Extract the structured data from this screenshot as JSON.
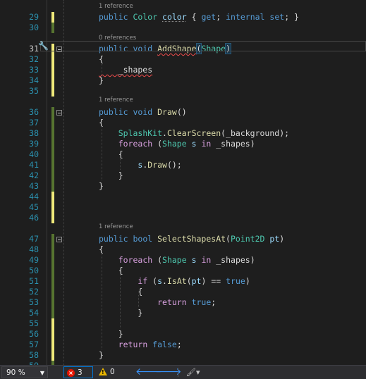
{
  "editor": {
    "lines": [
      {
        "n": "29",
        "lens": "1 reference",
        "tokens": [
          [
            "kw",
            "public "
          ],
          [
            "ty",
            "Color"
          ],
          [
            "pl",
            " "
          ],
          [
            "pm",
            "color"
          ],
          [
            "pl",
            " { "
          ],
          [
            "kw",
            "get"
          ],
          [
            "pl",
            "; "
          ],
          [
            "kw",
            "internal"
          ],
          [
            "pl",
            " "
          ],
          [
            "kw",
            "set"
          ],
          [
            "pl",
            "; }"
          ]
        ]
      },
      {
        "n": "30",
        "tokens": []
      },
      {
        "n": "31",
        "lens": "0 references",
        "tokens": [
          [
            "kw",
            "public "
          ],
          [
            "kw",
            "void"
          ],
          [
            "pl",
            " "
          ],
          [
            "mt",
            "AddShape"
          ],
          [
            "pl",
            "("
          ],
          [
            "ty",
            "Shape"
          ],
          [
            "pl",
            ")"
          ]
        ]
      },
      {
        "n": "32",
        "tokens": [
          [
            "pl",
            "{"
          ]
        ]
      },
      {
        "n": "33",
        "tokens": [
          [
            "pl",
            "    _shapes"
          ]
        ]
      },
      {
        "n": "34",
        "tokens": [
          [
            "pl",
            "}"
          ]
        ]
      },
      {
        "n": "35",
        "tokens": []
      },
      {
        "n": "36",
        "lens": "1 reference",
        "tokens": [
          [
            "kw",
            "public "
          ],
          [
            "kw",
            "void"
          ],
          [
            "pl",
            " "
          ],
          [
            "mt",
            "Draw"
          ],
          [
            "pl",
            "()"
          ]
        ]
      },
      {
        "n": "37",
        "tokens": [
          [
            "pl",
            "{"
          ]
        ]
      },
      {
        "n": "38",
        "tokens": [
          [
            "pl",
            "    "
          ],
          [
            "ty",
            "SplashKit"
          ],
          [
            "pl",
            "."
          ],
          [
            "mt",
            "ClearScreen"
          ],
          [
            "pl",
            "(_background);"
          ]
        ]
      },
      {
        "n": "39",
        "tokens": [
          [
            "pl",
            "    "
          ],
          [
            "ctrl",
            "foreach"
          ],
          [
            "pl",
            " ("
          ],
          [
            "ty",
            "Shape"
          ],
          [
            "pl",
            " "
          ],
          [
            "pm",
            "s"
          ],
          [
            "pl",
            " "
          ],
          [
            "ctrl",
            "in"
          ],
          [
            "pl",
            " _shapes)"
          ]
        ]
      },
      {
        "n": "40",
        "tokens": [
          [
            "pl",
            "    {"
          ]
        ]
      },
      {
        "n": "41",
        "tokens": [
          [
            "pl",
            "        "
          ],
          [
            "pm",
            "s"
          ],
          [
            "pl",
            "."
          ],
          [
            "mt",
            "Draw"
          ],
          [
            "pl",
            "();"
          ]
        ]
      },
      {
        "n": "42",
        "tokens": [
          [
            "pl",
            "    }"
          ]
        ]
      },
      {
        "n": "43",
        "tokens": [
          [
            "pl",
            "}"
          ]
        ]
      },
      {
        "n": "44",
        "tokens": []
      },
      {
        "n": "45",
        "tokens": []
      },
      {
        "n": "46",
        "tokens": []
      },
      {
        "n": "47",
        "lens": "1 reference",
        "tokens": [
          [
            "kw",
            "public "
          ],
          [
            "kw",
            "bool"
          ],
          [
            "pl",
            " "
          ],
          [
            "mt",
            "SelectShapesAt"
          ],
          [
            "pl",
            "("
          ],
          [
            "ty",
            "Point2D"
          ],
          [
            "pl",
            " "
          ],
          [
            "pm",
            "pt"
          ],
          [
            "pl",
            ")"
          ]
        ]
      },
      {
        "n": "48",
        "tokens": [
          [
            "pl",
            "{"
          ]
        ]
      },
      {
        "n": "49",
        "tokens": [
          [
            "pl",
            "    "
          ],
          [
            "ctrl",
            "foreach"
          ],
          [
            "pl",
            " ("
          ],
          [
            "ty",
            "Shape"
          ],
          [
            "pl",
            " "
          ],
          [
            "pm",
            "s"
          ],
          [
            "pl",
            " "
          ],
          [
            "ctrl",
            "in"
          ],
          [
            "pl",
            " _shapes)"
          ]
        ]
      },
      {
        "n": "50",
        "tokens": [
          [
            "pl",
            "    {"
          ]
        ]
      },
      {
        "n": "51",
        "tokens": [
          [
            "pl",
            "        "
          ],
          [
            "ctrl",
            "if"
          ],
          [
            "pl",
            " ("
          ],
          [
            "pm",
            "s"
          ],
          [
            "pl",
            "."
          ],
          [
            "mt",
            "IsAt"
          ],
          [
            "pl",
            "("
          ],
          [
            "pm",
            "pt"
          ],
          [
            "pl",
            ") == "
          ],
          [
            "kw",
            "true"
          ],
          [
            "pl",
            ")"
          ]
        ]
      },
      {
        "n": "52",
        "tokens": [
          [
            "pl",
            "        {"
          ]
        ]
      },
      {
        "n": "53",
        "tokens": [
          [
            "pl",
            "            "
          ],
          [
            "ctrl",
            "return"
          ],
          [
            "pl",
            " "
          ],
          [
            "kw",
            "true"
          ],
          [
            "pl",
            ";"
          ]
        ]
      },
      {
        "n": "54",
        "tokens": [
          [
            "pl",
            "        }"
          ]
        ]
      },
      {
        "n": "55",
        "tokens": []
      },
      {
        "n": "56",
        "tokens": [
          [
            "pl",
            "    }"
          ]
        ]
      },
      {
        "n": "57",
        "tokens": [
          [
            "pl",
            "    "
          ],
          [
            "ctrl",
            "return"
          ],
          [
            "pl",
            " "
          ],
          [
            "kw",
            "false"
          ],
          [
            "pl",
            ";"
          ]
        ]
      },
      {
        "n": "58",
        "tokens": [
          [
            "pl",
            "}"
          ]
        ]
      },
      {
        "n": "59",
        "tokens": []
      }
    ],
    "current_line": "31"
  },
  "status": {
    "zoom": "90 %",
    "errors": "3",
    "warnings": "0",
    "back_icon": "arrow-left-icon",
    "forward_icon": "arrow-right-icon",
    "brush_icon": "code-cleanup-icon",
    "error_color": "#e51400",
    "warning_color": "#e8b400",
    "accent": "#0078d7"
  }
}
